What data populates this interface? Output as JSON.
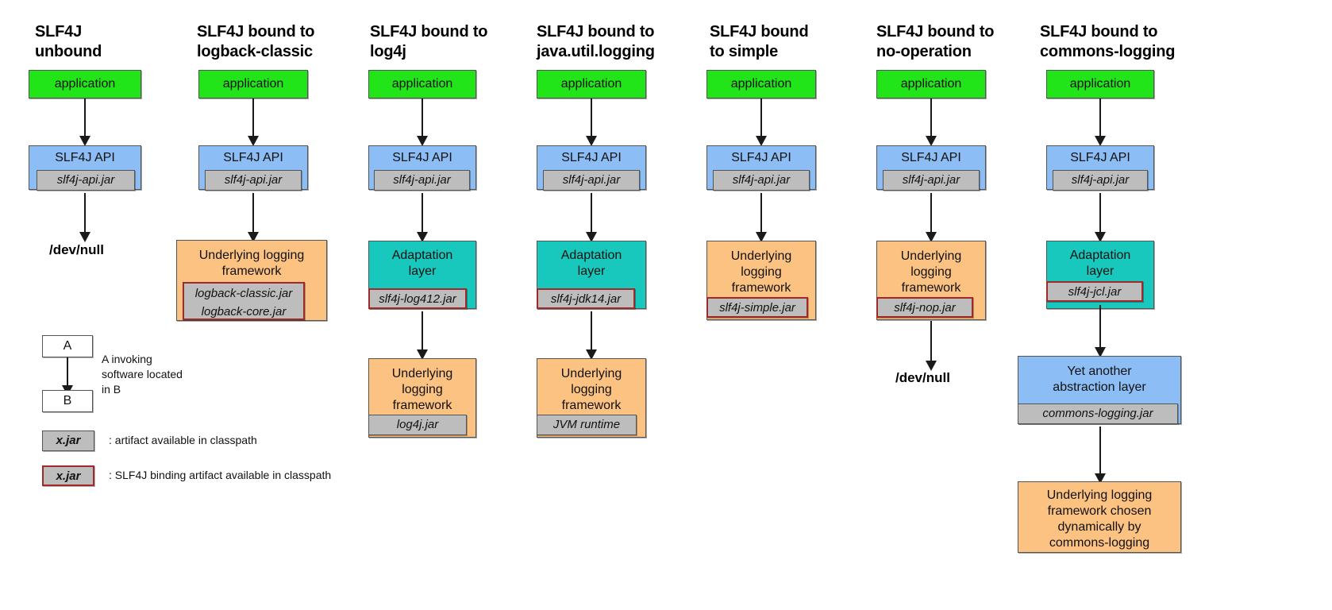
{
  "diagram": {
    "title_unused": "",
    "columns": [
      {
        "id": "unbound",
        "title": "SLF4J\nunbound",
        "nodes": [
          {
            "name": "application",
            "label": "application"
          },
          {
            "name": "slf4j-api",
            "label": "SLF4J API",
            "jar": "slf4j-api.jar"
          }
        ],
        "terminal": "/dev/null"
      },
      {
        "id": "logback-classic",
        "title": "SLF4J bound to\nlogback-classic",
        "nodes": [
          {
            "name": "application",
            "label": "application"
          },
          {
            "name": "slf4j-api",
            "label": "SLF4J API",
            "jar": "slf4j-api.jar"
          },
          {
            "name": "underlying-framework",
            "label": "Underlying logging\nframework",
            "jar": "logback-classic.jar\nlogback-core.jar"
          }
        ],
        "terminal": ""
      },
      {
        "id": "log4j",
        "title": "SLF4J bound to\nlog4j",
        "nodes": [
          {
            "name": "application",
            "label": "application"
          },
          {
            "name": "slf4j-api",
            "label": "SLF4J API",
            "jar": "slf4j-api.jar"
          },
          {
            "name": "adaptation-layer",
            "label": "Adaptation\nlayer",
            "jar": "slf4j-log412.jar"
          },
          {
            "name": "underlying-framework",
            "label": "Underlying\nlogging\nframework",
            "jar": "log4j.jar"
          }
        ],
        "terminal": ""
      },
      {
        "id": "java-util-logging",
        "title": "SLF4J bound to\njava.util.logging",
        "nodes": [
          {
            "name": "application",
            "label": "application"
          },
          {
            "name": "slf4j-api",
            "label": "SLF4J API",
            "jar": "slf4j-api.jar"
          },
          {
            "name": "adaptation-layer",
            "label": "Adaptation\nlayer",
            "jar": "slf4j-jdk14.jar"
          },
          {
            "name": "underlying-framework",
            "label": "Underlying\nlogging\nframework",
            "jar": "JVM runtime"
          }
        ],
        "terminal": ""
      },
      {
        "id": "simple",
        "title": "SLF4J bound\nto simple",
        "nodes": [
          {
            "name": "application",
            "label": "application"
          },
          {
            "name": "slf4j-api",
            "label": "SLF4J API",
            "jar": "slf4j-api.jar"
          },
          {
            "name": "underlying-framework",
            "label": "Underlying\nlogging\nframework",
            "jar": "slf4j-simple.jar"
          }
        ],
        "terminal": ""
      },
      {
        "id": "no-operation",
        "title": "SLF4J bound to\nno-operation",
        "nodes": [
          {
            "name": "application",
            "label": "application"
          },
          {
            "name": "slf4j-api",
            "label": "SLF4J API",
            "jar": "slf4j-api.jar"
          },
          {
            "name": "underlying-framework",
            "label": "Underlying\nlogging\nframework",
            "jar": "slf4j-nop.jar"
          }
        ],
        "terminal": "/dev/null"
      },
      {
        "id": "commons-logging",
        "title": "SLF4J bound to\ncommons-logging",
        "nodes": [
          {
            "name": "application",
            "label": "application"
          },
          {
            "name": "slf4j-api",
            "label": "SLF4J API",
            "jar": "slf4j-api.jar"
          },
          {
            "name": "adaptation-layer",
            "label": "Adaptation\nlayer",
            "jar": "slf4j-jcl.jar"
          },
          {
            "name": "abstraction-layer",
            "label": "Yet another\nabstraction layer",
            "jar": "commons-logging.jar"
          },
          {
            "name": "underlying-framework",
            "label": "Underlying logging\nframework chosen\ndynamically by\ncommons-logging"
          }
        ],
        "terminal": ""
      }
    ]
  },
  "legend": {
    "relation": {
      "from": "A",
      "to": "B",
      "description": "A invoking\nsoftware located\nin B"
    },
    "artifact": {
      "chip": "x.jar",
      "description": ": artifact available in classpath"
    },
    "binding_artifact": {
      "chip": "x.jar",
      "description": ": SLF4J binding artifact available in classpath"
    }
  },
  "colors": {
    "application": "#22e519",
    "api": "#8cbdf5",
    "adaptation": "#19c8bd",
    "underlying": "#fbc282",
    "jar": "#bdbdbd",
    "binding_border": "#9e2a2a",
    "arrow": "#1a1a1a"
  }
}
